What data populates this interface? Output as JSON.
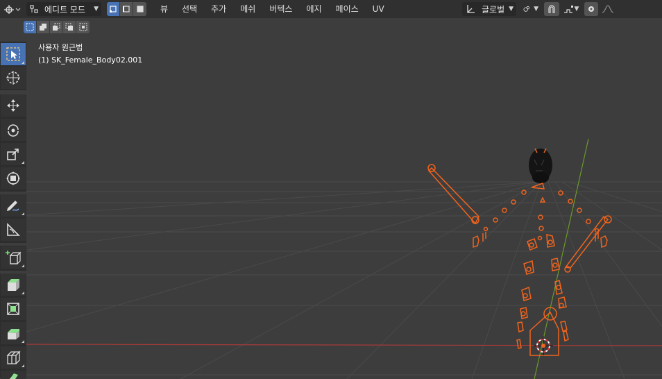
{
  "header": {
    "mode_label": "에디트 모드",
    "menus": [
      "뷰",
      "선택",
      "추가",
      "메쉬",
      "버텍스",
      "에지",
      "페이스",
      "UV"
    ],
    "transform_orientation": "글로벌"
  },
  "viewport": {
    "view_name": "사용자 원근법",
    "object_name": "(1) SK_Female_Body02.001"
  },
  "toolbar": {
    "tools": [
      "select-box",
      "cursor",
      "move",
      "rotate",
      "scale",
      "transform",
      "annotate",
      "measure",
      "add-cube",
      "extrude-region",
      "inset-faces",
      "bevel",
      "loop-cut"
    ]
  },
  "colors": {
    "accent": "#4772b3",
    "armature": "#f0641e",
    "x_axis": "#a83a3a",
    "y_axis": "#6a9a2a",
    "grid": "#4a4a4a"
  }
}
